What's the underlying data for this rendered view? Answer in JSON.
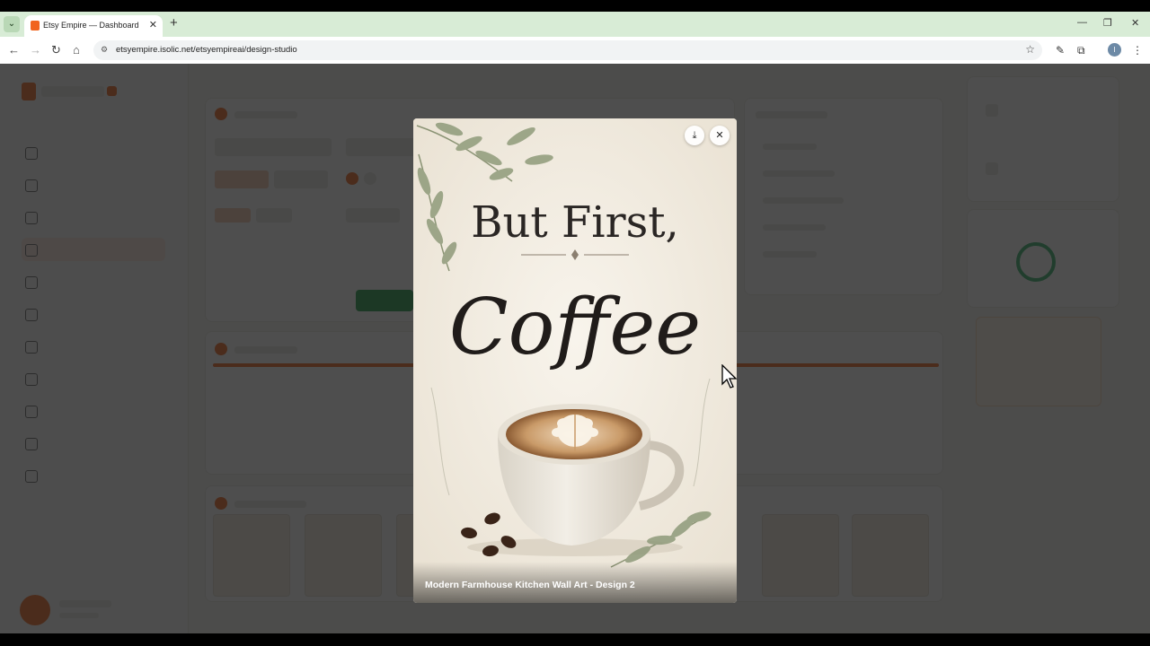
{
  "browser": {
    "tab_title": "Etsy Empire — Dashboard",
    "url": "etsyempire.isolic.net/etsyempireai/design-studio",
    "profile_initial": "I"
  },
  "icons": {
    "tab_menu": "chevron-down-icon",
    "favicon": "etsy-favicon",
    "tab_close": "close-icon",
    "new_tab": "plus-icon",
    "minimize": "minimize-icon",
    "maximize": "restore-icon",
    "window_close": "close-icon",
    "back": "arrow-left-icon",
    "forward": "arrow-right-icon",
    "reload": "reload-icon",
    "home": "home-icon",
    "site_settings": "tune-icon",
    "bookmark": "star-icon",
    "pen": "pen-icon",
    "extensions": "puzzle-icon",
    "menu": "more-vertical-icon",
    "download": "download-icon",
    "close_modal": "close-icon"
  },
  "glyphs": {
    "tab_menu": "⌄",
    "tab_close": "✕",
    "new_tab": "+",
    "minimize": "—",
    "maximize": "❐",
    "window_close": "✕",
    "back": "←",
    "forward": "→",
    "reload": "↻",
    "home": "⌂",
    "site_settings": "⚙",
    "bookmark": "☆",
    "pen": "✎",
    "extensions": "⧉",
    "menu": "⋮",
    "download": "⤓",
    "close_modal": "✕"
  },
  "modal": {
    "caption": "Modern Farmhouse Kitchen Wall Art - Design 2",
    "poster_line1": "But First,",
    "poster_line2": "Coffee"
  },
  "colors": {
    "accent": "#f1641e",
    "success": "#1f9d45",
    "tab_strip": "#d8ecd6"
  }
}
